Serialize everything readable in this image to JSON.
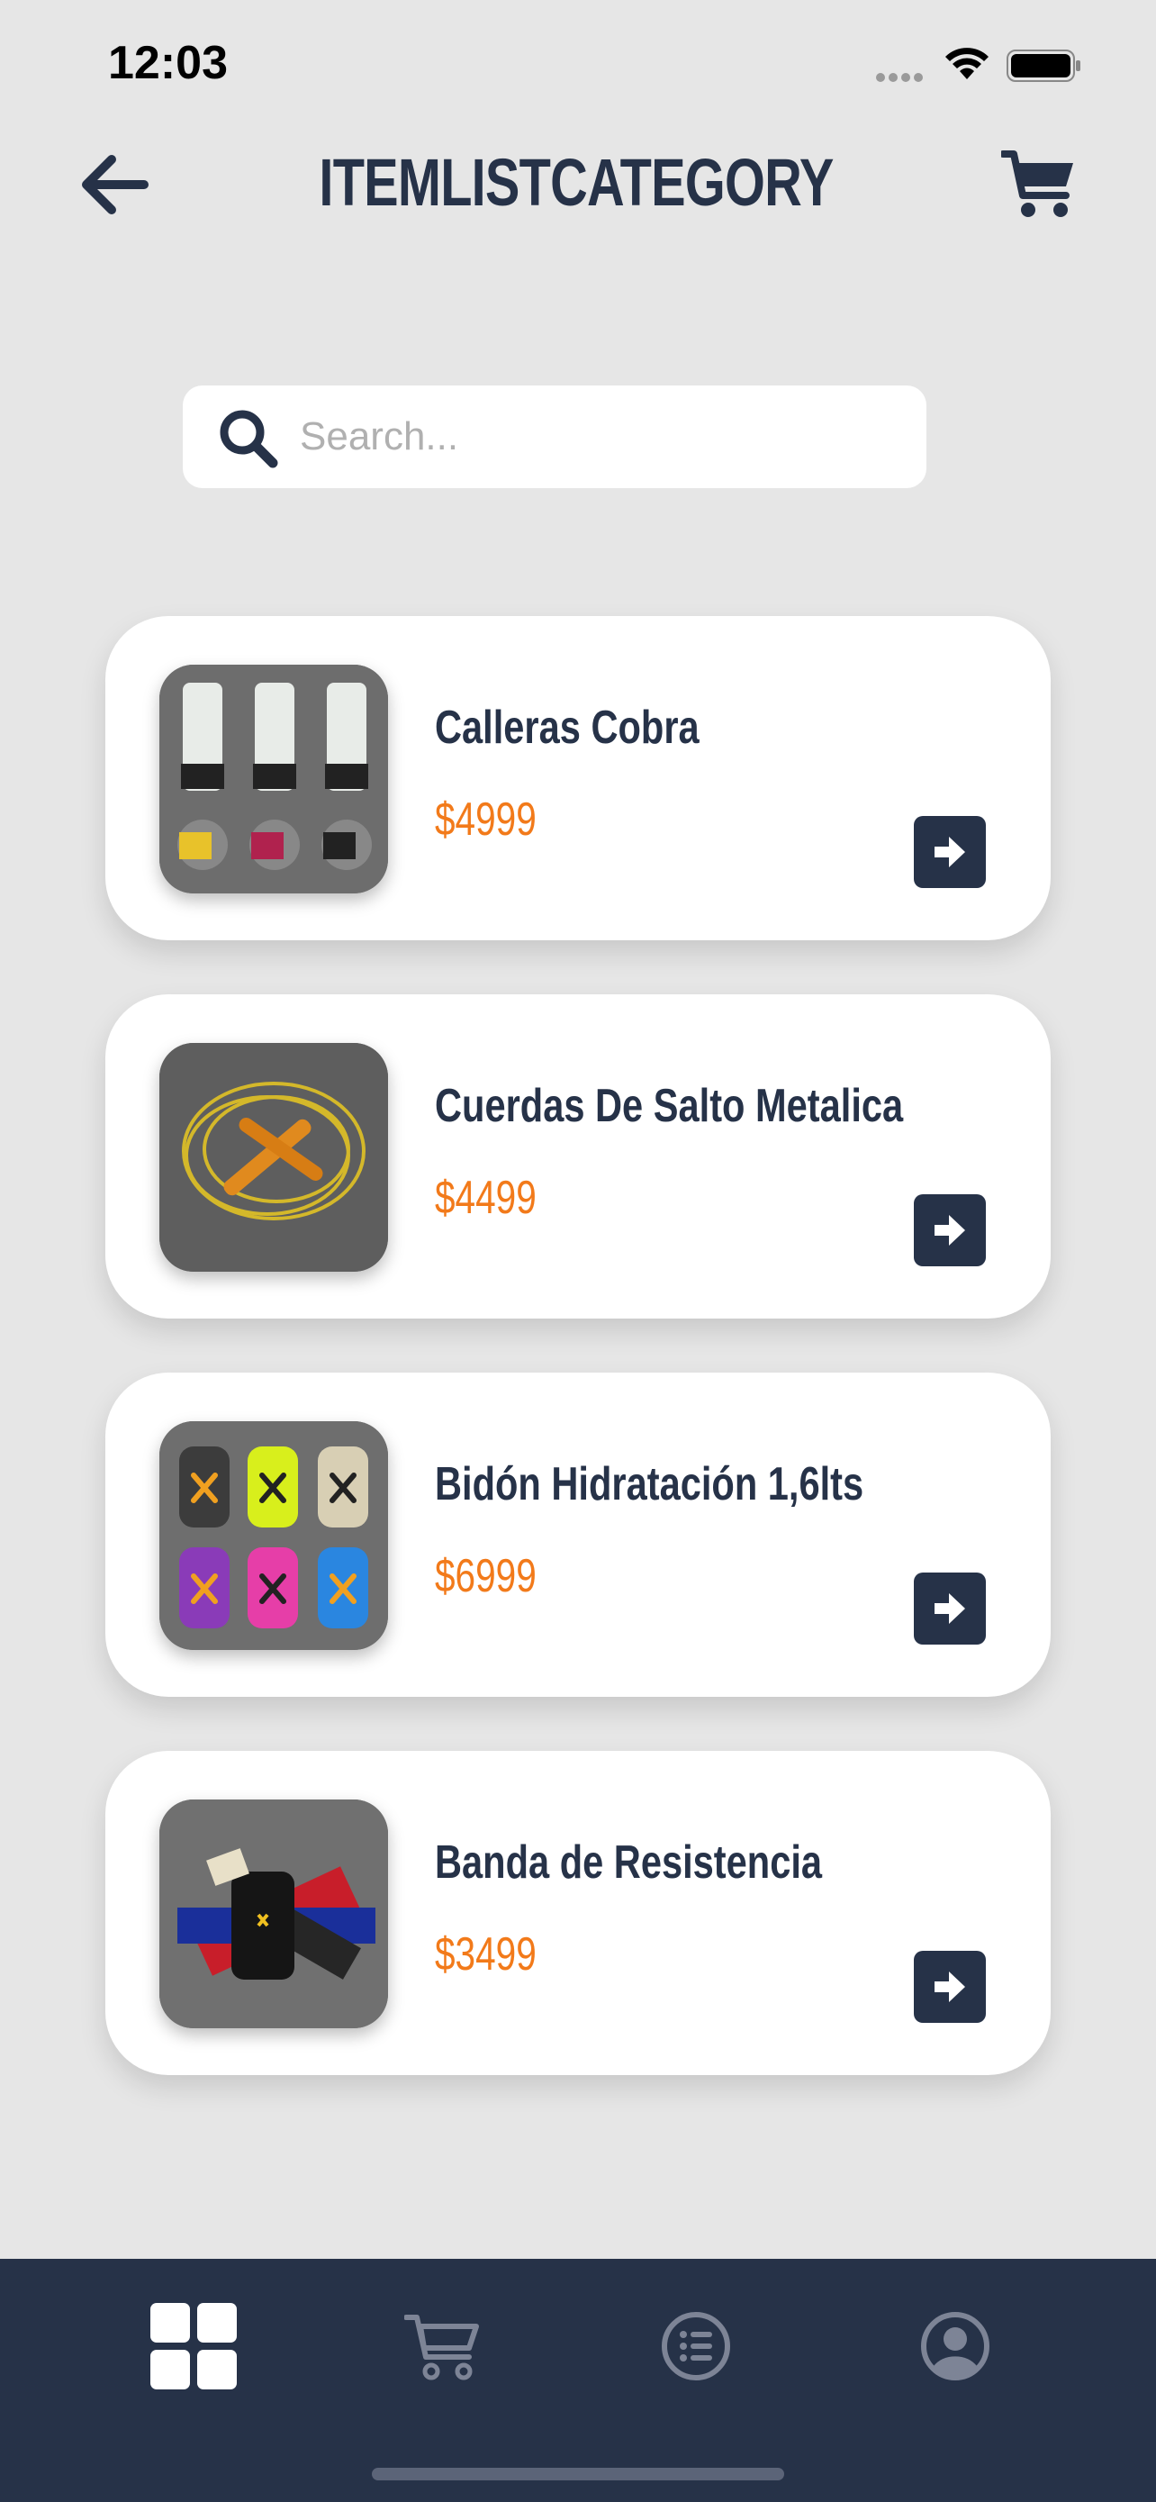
{
  "status_bar": {
    "time": "12:03"
  },
  "header": {
    "title": "ITEMLISTCATEGORY",
    "back_icon": "arrow-left-icon",
    "cart_icon": "cart-icon"
  },
  "search": {
    "placeholder": "Search...",
    "value": ""
  },
  "products": [
    {
      "name": "Calleras Cobra",
      "price": "$4999"
    },
    {
      "name": "Cuerdas De Salto Metalica",
      "price": "$4499"
    },
    {
      "name": "Bidón Hidratación 1,6lts",
      "price": "$6999"
    },
    {
      "name": "Banda de Resistencia",
      "price": "$3499"
    }
  ],
  "tab_bar": {
    "tabs": [
      {
        "icon": "grid-icon",
        "active": true
      },
      {
        "icon": "cart-icon",
        "active": false
      },
      {
        "icon": "list-icon",
        "active": false
      },
      {
        "icon": "profile-icon",
        "active": false
      }
    ]
  },
  "colors": {
    "navy": "#263248",
    "price_orange": "#f27a1a",
    "background": "#e6e6e6"
  }
}
